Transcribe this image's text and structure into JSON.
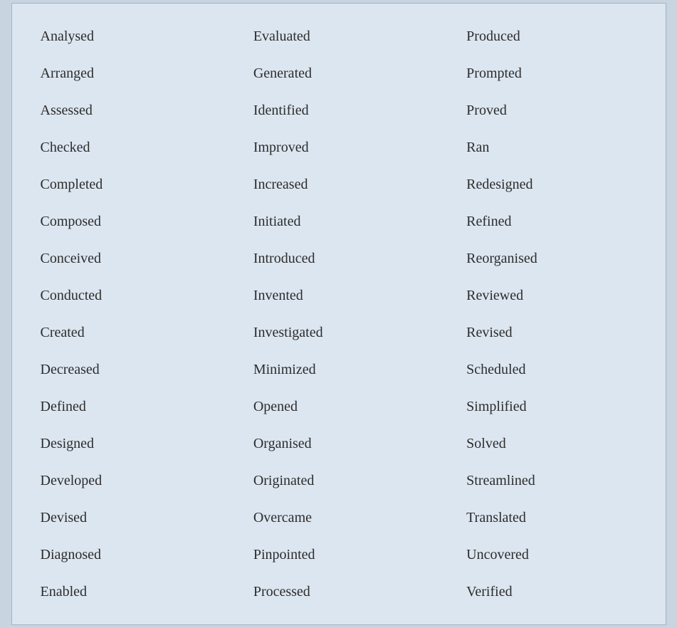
{
  "columns": [
    [
      "Analysed",
      "Arranged",
      "Assessed",
      "Checked",
      "Completed",
      "Composed",
      "Conceived",
      "Conducted",
      "Created",
      "Decreased",
      "Defined",
      "Designed",
      "Developed",
      "Devised",
      "Diagnosed",
      "Enabled"
    ],
    [
      "Evaluated",
      "Generated",
      "Identified",
      "Improved",
      "Increased",
      "Initiated",
      "Introduced",
      "Invented",
      "Investigated",
      "Minimized",
      "Opened",
      "Organised",
      "Originated",
      "Overcame",
      "Pinpointed",
      "Processed"
    ],
    [
      "Produced",
      "Prompted",
      "Proved",
      "Ran",
      "Redesigned",
      "Refined",
      "Reorganised",
      "Reviewed",
      "Revised",
      "Scheduled",
      "Simplified",
      "Solved",
      "Streamlined",
      "Translated",
      "Uncovered",
      "Verified"
    ]
  ]
}
